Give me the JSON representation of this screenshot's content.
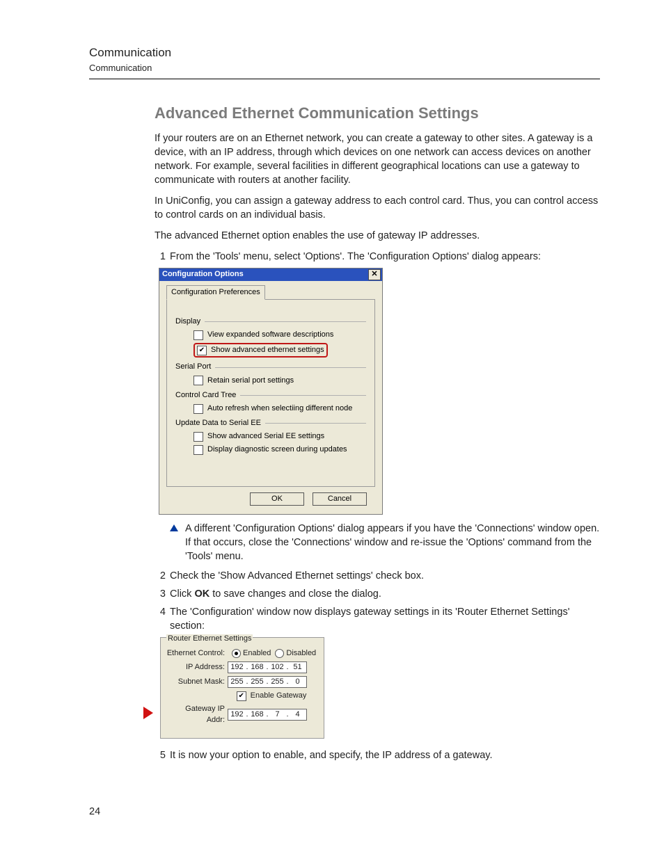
{
  "header": {
    "title": "Communication",
    "subtitle": "Communication"
  },
  "section_title": "Advanced Ethernet Communication Settings",
  "para1": "If your routers are on an Ethernet network, you can create a gateway to other sites. A gateway is a device, with an IP address, through which devices on one network can access devices on another network. For example, several facilities in different geographical locations can use a gateway to communicate with routers at another facility.",
  "para2": "In UniConfig, you can assign a gateway address to each control card. Thus, you can control access to control cards on an individual basis.",
  "para3": "The advanced Ethernet option enables the use of gateway IP addresses.",
  "steps": {
    "s1": "From the 'Tools' menu, select 'Options'. The 'Configuration Options' dialog appears:",
    "note": "A different 'Configuration Options' dialog appears if you have the 'Connections' window open. If that occurs, close the 'Connections' window and re-issue the 'Options' command from the 'Tools' menu.",
    "s2": "Check the 'Show Advanced Ethernet settings' check box.",
    "s3_pre": "Click ",
    "s3_bold": "OK",
    "s3_post": " to save changes and close the dialog.",
    "s4": "The 'Configuration' window now displays gateway settings in its 'Router Ethernet Settings' section:",
    "s5": "It is now your option to enable, and specify, the IP address of a gateway."
  },
  "dlg": {
    "title": "Configuration Options",
    "tab": "Configuration Preferences",
    "groups": {
      "display": "Display",
      "serial": "Serial Port",
      "tree": "Control Card Tree",
      "update": "Update Data to Serial EE"
    },
    "opts": {
      "view_expanded": "View expanded software descriptions",
      "show_adv_eth": "Show advanced ethernet settings",
      "retain_serial": "Retain serial port settings",
      "auto_refresh": "Auto refresh when selectiing different node",
      "show_adv_ee": "Show advanced Serial EE settings",
      "display_diag": "Display diagnostic screen during updates"
    },
    "ok": "OK",
    "cancel": "Cancel"
  },
  "res": {
    "legend": "Router Ethernet Settings",
    "eth_ctrl": "Ethernet Control:",
    "enabled": "Enabled",
    "disabled": "Disabled",
    "ip_label": "IP Address:",
    "ip": [
      "192",
      "168",
      "102",
      "51"
    ],
    "mask_label": "Subnet Mask:",
    "mask": [
      "255",
      "255",
      "255",
      "0"
    ],
    "enable_gw": "Enable Gateway",
    "gw_label": "Gateway IP Addr:",
    "gw": [
      "192",
      "168",
      "7",
      "4"
    ]
  },
  "page_number": "24"
}
